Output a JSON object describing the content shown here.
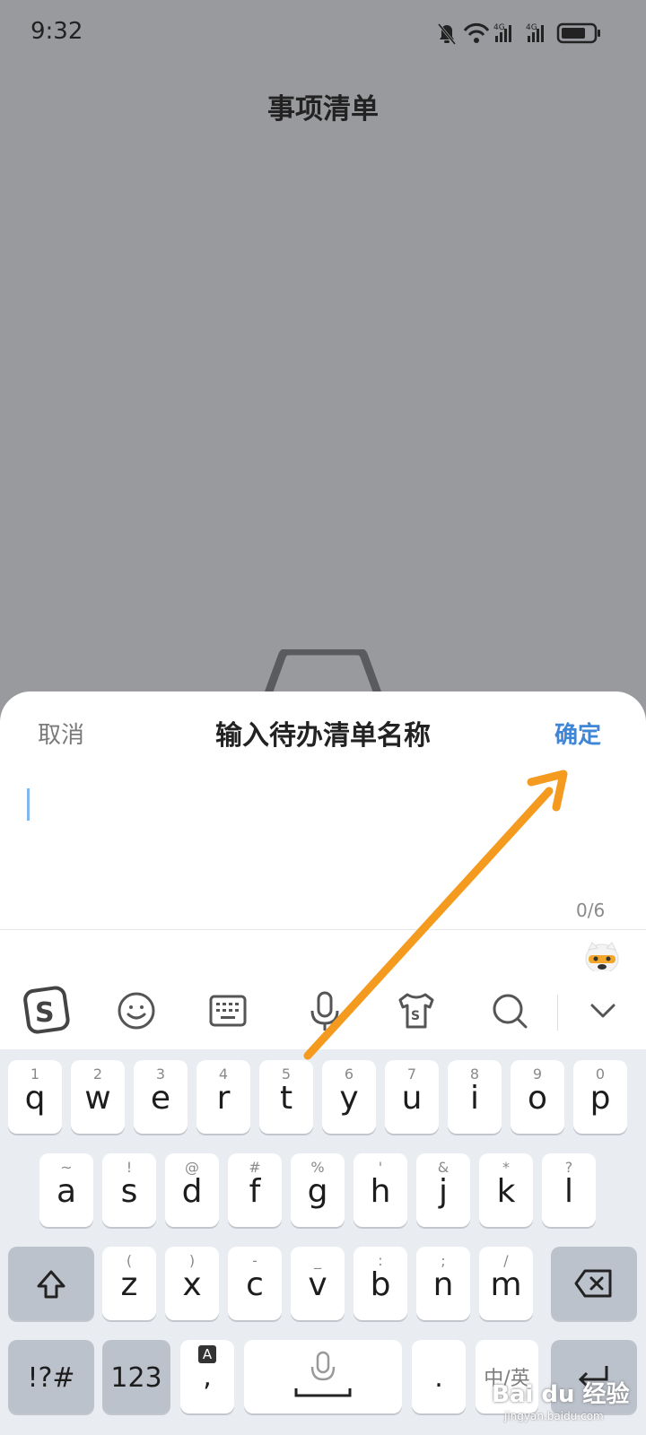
{
  "status_bar": {
    "time": "9:32",
    "icons": [
      "bell-muted-icon",
      "wifi-icon",
      "signal-4g-icon",
      "signal-4g-icon",
      "battery-icon"
    ],
    "net1": "4G",
    "net2": "4G"
  },
  "page": {
    "title": "事项清单"
  },
  "sheet": {
    "cancel_label": "取消",
    "title": "输入待办清单名称",
    "confirm_label": "确定",
    "confirm_color": "#3f86d6",
    "char_count": "0/6"
  },
  "toolbar": {
    "items": [
      "sogou-logo-icon",
      "emoji-icon",
      "keyboard-icon",
      "microphone-icon",
      "skin-icon",
      "search-icon",
      "collapse-chevron-icon"
    ]
  },
  "keyboard": {
    "row1": [
      {
        "hint": "1",
        "key": "q"
      },
      {
        "hint": "2",
        "key": "w"
      },
      {
        "hint": "3",
        "key": "e"
      },
      {
        "hint": "4",
        "key": "r"
      },
      {
        "hint": "5",
        "key": "t"
      },
      {
        "hint": "6",
        "key": "y"
      },
      {
        "hint": "7",
        "key": "u"
      },
      {
        "hint": "8",
        "key": "i"
      },
      {
        "hint": "9",
        "key": "o"
      },
      {
        "hint": "0",
        "key": "p"
      }
    ],
    "row2": [
      {
        "hint": "~",
        "key": "a"
      },
      {
        "hint": "!",
        "key": "s"
      },
      {
        "hint": "@",
        "key": "d"
      },
      {
        "hint": "#",
        "key": "f"
      },
      {
        "hint": "%",
        "key": "g"
      },
      {
        "hint": "'",
        "key": "h"
      },
      {
        "hint": "&",
        "key": "j"
      },
      {
        "hint": "*",
        "key": "k"
      },
      {
        "hint": "?",
        "key": "l"
      }
    ],
    "row3": [
      {
        "hint": "(",
        "key": "z"
      },
      {
        "hint": ")",
        "key": "x"
      },
      {
        "hint": "-",
        "key": "c"
      },
      {
        "hint": "_",
        "key": "v"
      },
      {
        "hint": ":",
        "key": "b"
      },
      {
        "hint": ";",
        "key": "n"
      },
      {
        "hint": "/",
        "key": "m"
      }
    ],
    "row4": {
      "symbols": "!?#",
      "numbers": "123",
      "comma": ",",
      "comma_hint": "A",
      "period": ".",
      "lang_switch": "中/英",
      "enter_icon": "enter-icon"
    }
  },
  "annotation": {
    "arrow_color": "#f39a1f"
  },
  "watermark": {
    "brand": "Bai du 经验",
    "url": "jingyan.baidu.com"
  }
}
